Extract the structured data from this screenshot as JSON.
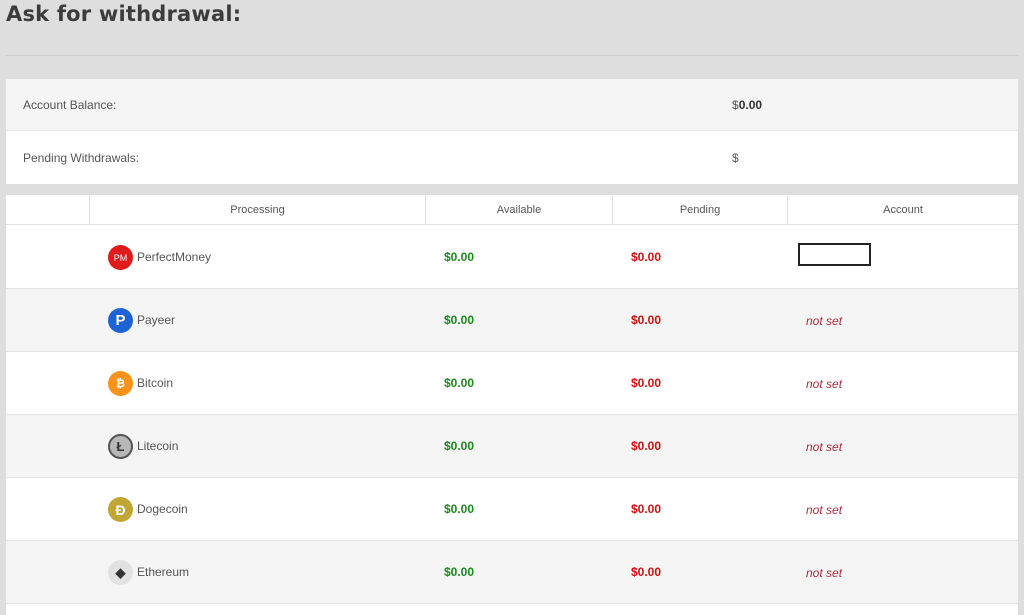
{
  "page": {
    "title": "Ask for withdrawal:"
  },
  "summary": {
    "balance_label": "Account Balance:",
    "balance_currency": "$",
    "balance_value": "0.00",
    "pending_label": "Pending Withdrawals:",
    "pending_currency": "$",
    "pending_value": ""
  },
  "table": {
    "headers": [
      "",
      "Processing",
      "Available",
      "Pending",
      "Account"
    ],
    "rows": [
      {
        "name": "PerfectMoney",
        "icon": "perfectmoney-icon",
        "icon_text": "PM",
        "available": "$0.00",
        "pending": "$0.00",
        "account": ""
      },
      {
        "name": "Payeer",
        "icon": "payeer-icon",
        "icon_text": "P",
        "available": "$0.00",
        "pending": "$0.00",
        "account": "not set"
      },
      {
        "name": "Bitcoin",
        "icon": "bitcoin-icon",
        "icon_text": "₿",
        "available": "$0.00",
        "pending": "$0.00",
        "account": "not set"
      },
      {
        "name": "Litecoin",
        "icon": "litecoin-icon",
        "icon_text": "Ł",
        "available": "$0.00",
        "pending": "$0.00",
        "account": "not set"
      },
      {
        "name": "Dogecoin",
        "icon": "dogecoin-icon",
        "icon_text": "Ð",
        "available": "$0.00",
        "pending": "$0.00",
        "account": "not set"
      },
      {
        "name": "Ethereum",
        "icon": "ethereum-icon",
        "icon_text": "◆",
        "available": "$0.00",
        "pending": "$0.00",
        "account": "not set"
      }
    ]
  },
  "colors": {
    "available": "#1a8a1a",
    "pending": "#d01010",
    "not_set": "#b0283c",
    "perfectmoney": "#e01b1b",
    "payeer": "#1e63d6",
    "bitcoin": "#f7931a",
    "litecoin": "#9a9a9a",
    "dogecoin": "#c2a633",
    "ethereum": "#e2e2e2"
  }
}
